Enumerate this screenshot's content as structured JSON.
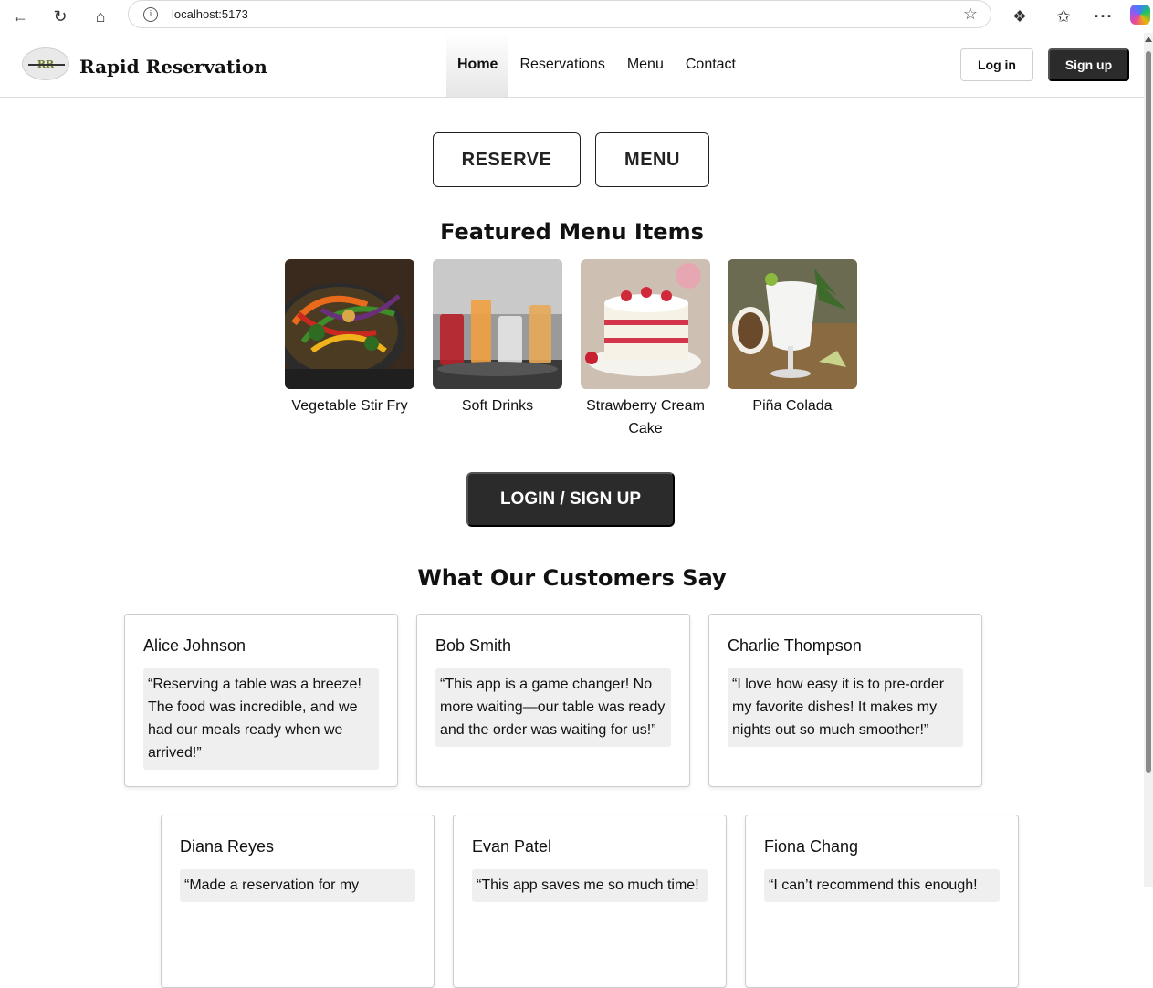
{
  "browser": {
    "url": "localhost:5173"
  },
  "header": {
    "brand": "Rapid Reservation",
    "logo_text": "RR",
    "nav": [
      {
        "label": "Home",
        "active": true
      },
      {
        "label": "Reservations"
      },
      {
        "label": "Menu"
      },
      {
        "label": "Contact"
      }
    ],
    "login_label": "Log in",
    "signup_label": "Sign up"
  },
  "hero": {
    "reserve_label": "RESERVE",
    "menu_label": "MENU"
  },
  "featured": {
    "title": "Featured Menu Items",
    "items": [
      {
        "name": "Vegetable Stir Fry"
      },
      {
        "name": "Soft Drinks"
      },
      {
        "name": "Strawberry Cream Cake"
      },
      {
        "name": "Piña Colada"
      }
    ]
  },
  "cta_label": "LOGIN / SIGN UP",
  "reviews": {
    "title": "What Our Customers Say",
    "items": [
      {
        "name": "Alice Johnson",
        "quote": "“Reserving a table was a breeze! The food was incredible, and we had our meals ready when we arrived!”"
      },
      {
        "name": "Bob Smith",
        "quote": "“This app is a game changer! No more waiting—our table was ready and the order was waiting for us!”"
      },
      {
        "name": "Charlie Thompson",
        "quote": "“I love how easy it is to pre-order my favorite dishes! It makes my nights out so much smoother!”"
      },
      {
        "name": "Diana Reyes",
        "quote": "“Made a reservation for my"
      },
      {
        "name": "Evan Patel",
        "quote": "“This app saves me so much time!"
      },
      {
        "name": "Fiona Chang",
        "quote": "“I can’t recommend this enough!"
      }
    ]
  },
  "colors": {
    "dark_button": "#2b2b2b",
    "quote_bg": "#efefef",
    "logo_accent": "#6b7d2c"
  }
}
